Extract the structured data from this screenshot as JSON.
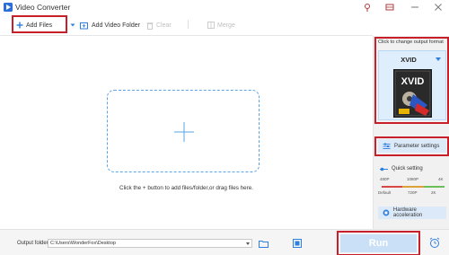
{
  "window": {
    "title": "Video Converter",
    "icons": [
      "app-logo-icon",
      "pin-icon",
      "cart-icon",
      "minimize-icon",
      "close-icon"
    ]
  },
  "toolbar": {
    "add_files": "Add Files",
    "add_video_folder": "Add Video Folder",
    "clear": "Clear",
    "merge": "Merge"
  },
  "main": {
    "hint": "Click the + button to add files/folder,or drag files here."
  },
  "panel": {
    "format_caption": "Click to change output format",
    "format_name": "XVID",
    "thumb_text": "XVID",
    "parameter_settings": "Parameter settings",
    "quick_setting": "Quick setting",
    "quality_top": [
      "480P",
      "1080P",
      "4K"
    ],
    "quality_bottom": [
      "Default",
      "720P",
      "2K"
    ],
    "hardware_acceleration": "Hardware acceleration"
  },
  "bottom": {
    "output_label": "Output folder:",
    "output_path": "C:\\Users\\WonderFox\\Desktop",
    "run": "Run"
  },
  "colors": {
    "accent": "#2d7fe0",
    "highlight": "#c8202a",
    "run_bg": "#c9e0f6"
  }
}
